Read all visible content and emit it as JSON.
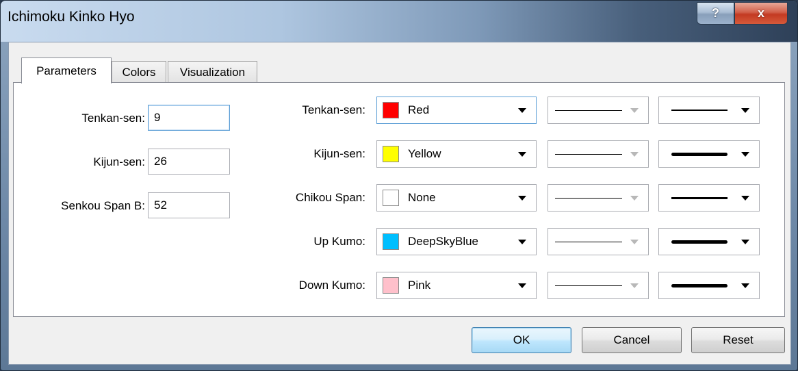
{
  "window": {
    "title": "Ichimoku Kinko Hyo",
    "help_label": "?",
    "close_label": "x"
  },
  "tabs": [
    {
      "label": "Parameters",
      "active": true
    },
    {
      "label": "Colors",
      "active": false
    },
    {
      "label": "Visualization",
      "active": false
    }
  ],
  "parameters": [
    {
      "label": "Tenkan-sen:",
      "value": "9"
    },
    {
      "label": "Kijun-sen:",
      "value": "26"
    },
    {
      "label": "Senkou Span B:",
      "value": "52"
    }
  ],
  "lines": [
    {
      "label": "Tenkan-sen:",
      "color_name": "Red",
      "color": "#ff0000"
    },
    {
      "label": "Kijun-sen:",
      "color_name": "Yellow",
      "color": "#ffff00"
    },
    {
      "label": "Chikou Span:",
      "color_name": "None",
      "color": "#ffffff"
    },
    {
      "label": "Up Kumo:",
      "color_name": "DeepSkyBlue",
      "color": "#00bfff"
    },
    {
      "label": "Down Kumo:",
      "color_name": "Pink",
      "color": "#ffc0cb"
    }
  ],
  "buttons": {
    "ok": "OK",
    "cancel": "Cancel",
    "reset": "Reset"
  }
}
